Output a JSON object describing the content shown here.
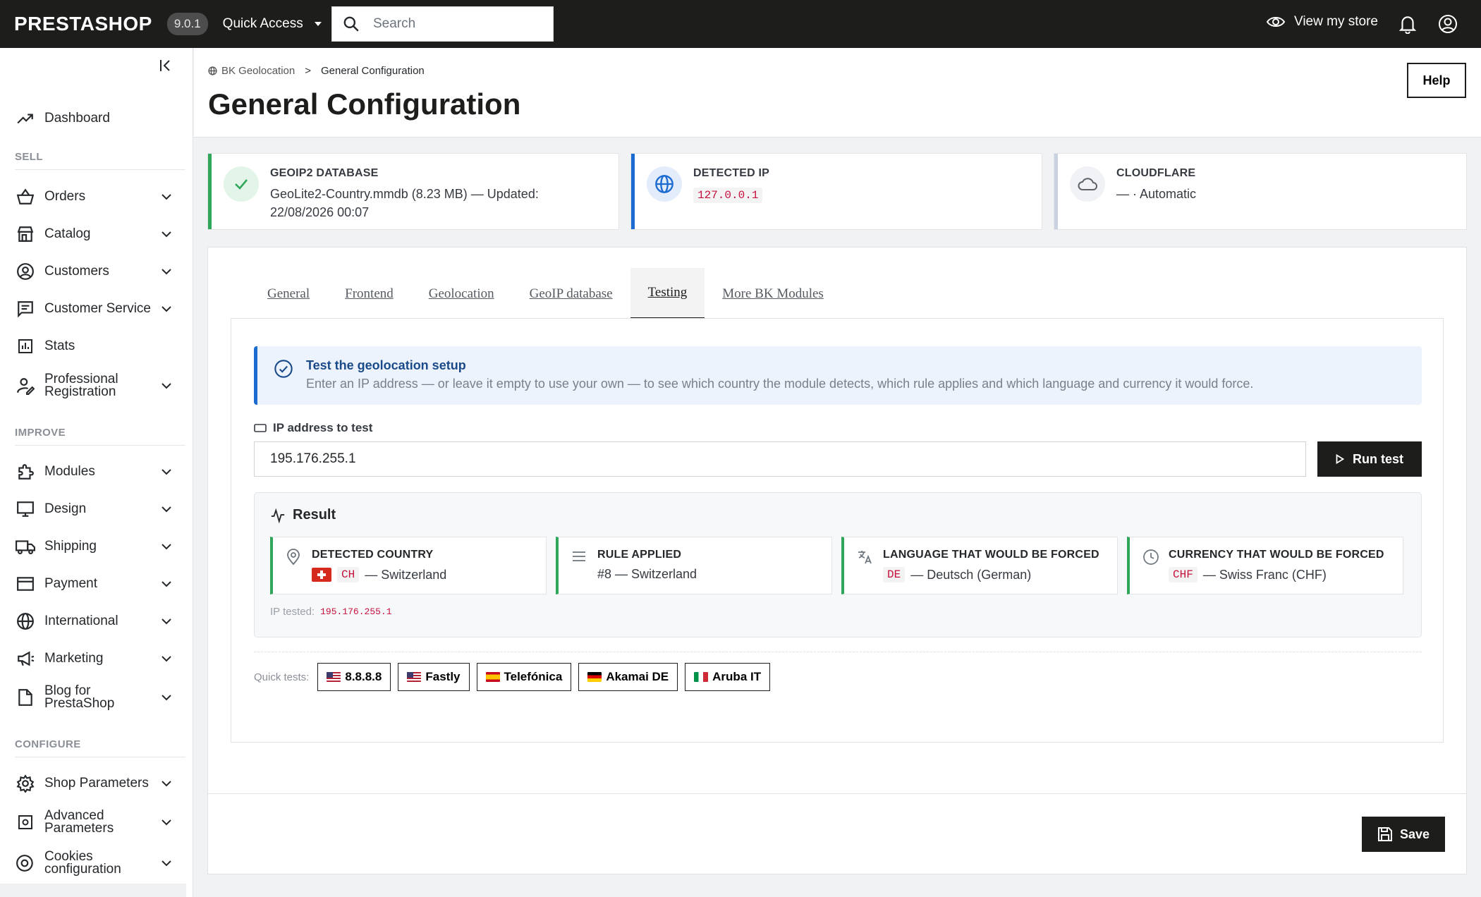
{
  "topbar": {
    "logo": "PRESTASHOP",
    "version": "9.0.1",
    "quick_access": "Quick Access",
    "search_placeholder": "Search",
    "view_store": "View my store"
  },
  "sidebar": {
    "items": [
      {
        "label": "Dashboard"
      },
      {
        "section": "SELL"
      },
      {
        "label": "Orders"
      },
      {
        "label": "Catalog"
      },
      {
        "label": "Customers"
      },
      {
        "label": "Customer Service"
      },
      {
        "label": "Stats"
      },
      {
        "label": "Professional Registration"
      },
      {
        "section": "IMPROVE"
      },
      {
        "label": "Modules"
      },
      {
        "label": "Design"
      },
      {
        "label": "Shipping"
      },
      {
        "label": "Payment"
      },
      {
        "label": "International"
      },
      {
        "label": "Marketing"
      },
      {
        "label": "Blog for PrestaShop"
      },
      {
        "section": "CONFIGURE"
      },
      {
        "label": "Shop Parameters"
      },
      {
        "label": "Advanced Parameters"
      },
      {
        "label": "Cookies configuration"
      }
    ]
  },
  "header": {
    "breadcrumb": [
      "BK Geolocation",
      "General Configuration"
    ],
    "breadcrumb_sep": ">",
    "title": "General Configuration",
    "help": "Help"
  },
  "info_cards": [
    {
      "caption": "GEOIP2 DATABASE",
      "value": "GeoLite2-Country.mmdb (8.23 MB) — Updated: 22/08/2026 00:07",
      "accent": "#2fa659"
    },
    {
      "caption": "DETECTED IP",
      "value": "127.0.0.1",
      "accent": "#1c6bd1"
    },
    {
      "caption": "CLOUDFLARE",
      "value": "— · Automatic",
      "accent": "#c9d2e0"
    }
  ],
  "tabs": [
    "General",
    "Frontend",
    "Geolocation",
    "GeoIP database",
    "Testing",
    "More BK Modules"
  ],
  "active_tab": "Testing",
  "testing": {
    "alert_title": "Test the geolocation setup",
    "alert_body": "Enter an IP address — or leave it empty to use your own — to see which country the module detects, which rule applies and which language and currency it would force.",
    "field_label": "IP address to test",
    "ip_value": "195.176.255.1",
    "run_button": "Run test",
    "result_title": "Result",
    "result_cards": [
      {
        "caption": "DETECTED COUNTRY",
        "code": "CH",
        "value": "— Switzerland"
      },
      {
        "caption": "RULE APPLIED",
        "value": "#8 — Switzerland"
      },
      {
        "caption": "LANGUAGE THAT WOULD BE FORCED",
        "code": "DE",
        "value": "— Deutsch (German)"
      },
      {
        "caption": "CURRENCY THAT WOULD BE FORCED",
        "code": "CHF",
        "value": "— Swiss Franc (CHF)"
      }
    ],
    "ip_tested_label": "IP tested:",
    "ip_tested_value": "195.176.255.1",
    "quick_tests_label": "Quick tests:",
    "quick_tests": [
      {
        "label": "8.8.8.8",
        "flag": "us"
      },
      {
        "label": "Fastly",
        "flag": "us"
      },
      {
        "label": "Telefónica",
        "flag": "es"
      },
      {
        "label": "Akamai DE",
        "flag": "de"
      },
      {
        "label": "Aruba IT",
        "flag": "it"
      }
    ]
  },
  "save": "Save",
  "colors": {
    "topbar": "#1d1d1b",
    "success": "#2fa659",
    "info": "#1c6bd1",
    "code": "#c5113d"
  }
}
